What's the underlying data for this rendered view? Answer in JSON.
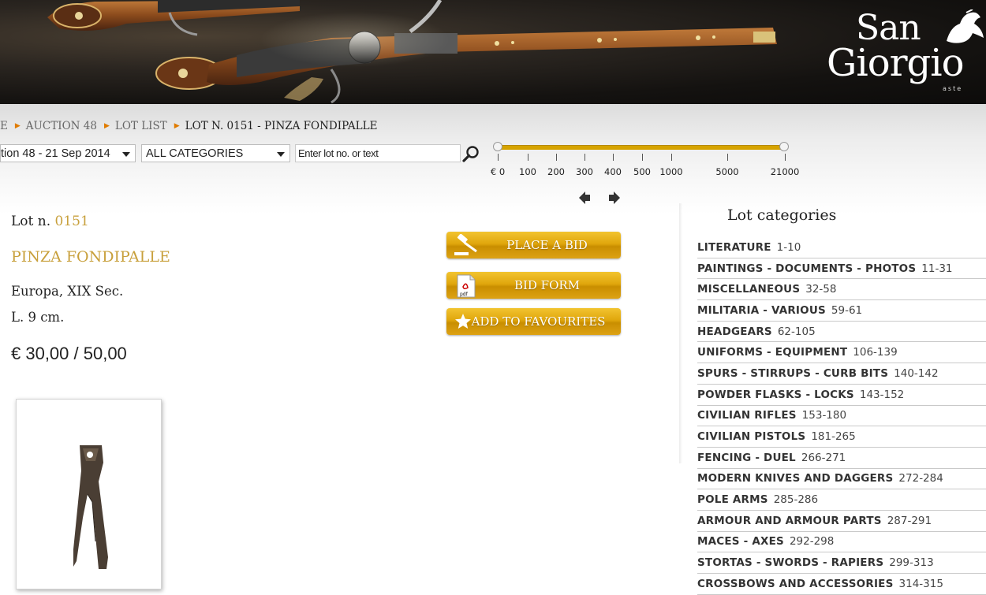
{
  "header": {
    "logo": {
      "line1": "San",
      "line2": "Giorgio",
      "line3": "aste"
    }
  },
  "breadcrumb": [
    {
      "label": "E"
    },
    {
      "label": "AUCTION 48"
    },
    {
      "label": "LOT LIST"
    },
    {
      "label": "LOT N. 0151 - PINZA FONDIPALLE"
    }
  ],
  "filters": {
    "auction_select": "tion 48 - 21 Sep 2014",
    "category_select": "ALL CATEGORIES",
    "search_placeholder": "Enter lot no. or text"
  },
  "price_slider": {
    "ticks": [
      "€ 0",
      "100",
      "200",
      "300",
      "400",
      "500",
      "1000",
      "5000",
      "21000"
    ]
  },
  "lot": {
    "number_label": "Lot n.",
    "number": "0151",
    "title": "PINZA FONDIPALLE",
    "origin": "Europa, XIX Sec.",
    "dimensions": "L. 9 cm.",
    "estimate": "€ 30,00 / 50,00"
  },
  "actions": {
    "place_bid": "PLACE A BID",
    "bid_form": "BID FORM",
    "bid_form_icon_text": "pdf",
    "add_favourites": "ADD TO FAVOURITES"
  },
  "categories": {
    "heading": "Lot categories",
    "items": [
      {
        "name": "LITERATURE",
        "range": "1-10"
      },
      {
        "name": "PAINTINGS - DOCUMENTS - PHOTOS",
        "range": "11-31"
      },
      {
        "name": "MISCELLANEOUS",
        "range": "32-58"
      },
      {
        "name": "MILITARIA - VARIOUS",
        "range": "59-61"
      },
      {
        "name": "HEADGEARS",
        "range": "62-105"
      },
      {
        "name": "UNIFORMS - EQUIPMENT",
        "range": "106-139"
      },
      {
        "name": "SPURS - STIRRUPS - CURB BITS",
        "range": "140-142"
      },
      {
        "name": "POWDER FLASKS - LOCKS",
        "range": "143-152"
      },
      {
        "name": "CIVILIAN RIFLES",
        "range": "153-180"
      },
      {
        "name": "CIVILIAN PISTOLS",
        "range": "181-265"
      },
      {
        "name": "FENCING - DUEL",
        "range": "266-271"
      },
      {
        "name": "MODERN KNIVES AND DAGGERS",
        "range": "272-284"
      },
      {
        "name": "POLE ARMS",
        "range": "285-286"
      },
      {
        "name": "ARMOUR AND ARMOUR PARTS",
        "range": "287-291"
      },
      {
        "name": "MACES - AXES",
        "range": "292-298"
      },
      {
        "name": "STORTAS - SWORDS - RAPIERS",
        "range": "299-313"
      },
      {
        "name": "CROSSBOWS AND ACCESSORIES",
        "range": "314-315"
      }
    ]
  },
  "colors": {
    "accent_gold": "#c8a03c",
    "button_gold": "#e0a60c",
    "breadcrumb_arrow": "#e07b00"
  }
}
